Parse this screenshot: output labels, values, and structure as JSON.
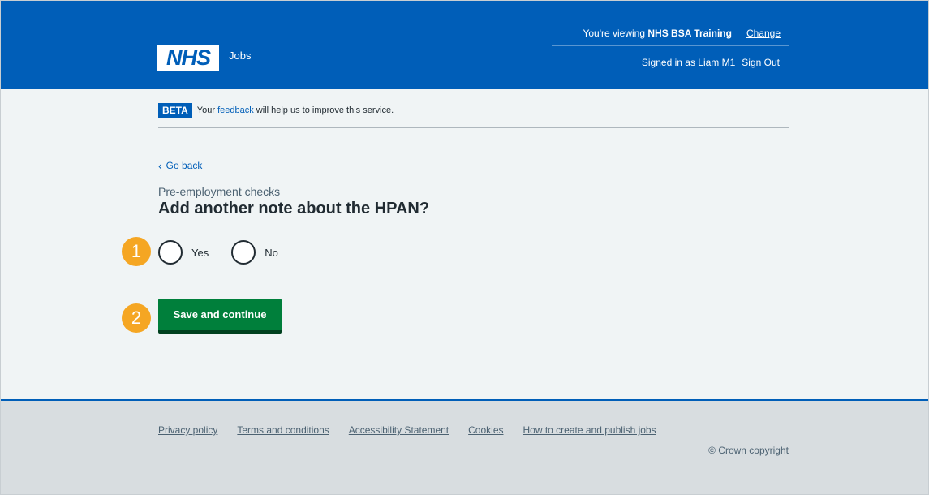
{
  "header": {
    "logo_text": "NHS",
    "service_name": "Jobs",
    "viewing_prefix": "You're viewing ",
    "organisation": "NHS BSA Training",
    "change_label": "Change",
    "signed_in_prefix": "Signed in as ",
    "user_name": "Liam M1",
    "sign_out_label": "Sign Out"
  },
  "beta_banner": {
    "tag": "BETA",
    "text_before": "Your ",
    "link_text": "feedback",
    "text_after": " will help us to improve this service."
  },
  "main": {
    "back_label": "Go back",
    "caption": "Pre-employment checks",
    "heading": "Add another note about the HPAN?",
    "options": [
      {
        "label": "Yes"
      },
      {
        "label": "No"
      }
    ],
    "save_label": "Save and continue"
  },
  "markers": [
    "1",
    "2"
  ],
  "footer": {
    "links": [
      "Privacy policy",
      "Terms and conditions",
      "Accessibility Statement",
      "Cookies",
      "How to create and publish jobs"
    ],
    "copyright": "© Crown copyright"
  },
  "colors": {
    "brand_blue": "#005eb8",
    "button_green": "#007f3b",
    "marker_orange": "#f5a623",
    "page_bg": "#f0f4f5",
    "footer_bg": "#d8dde0"
  }
}
